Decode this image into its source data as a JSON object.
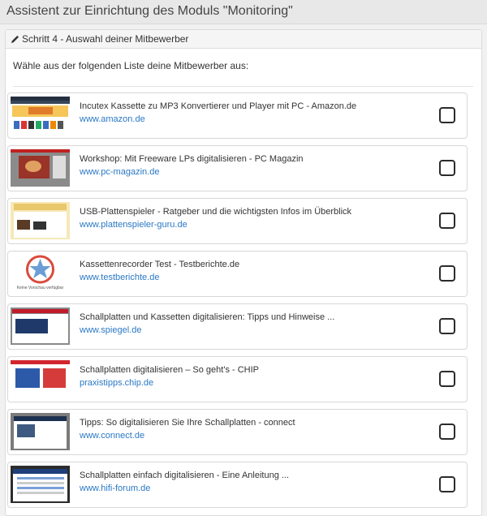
{
  "page": {
    "title": "Assistent zur Einrichtung des Moduls \"Monitoring\""
  },
  "panel": {
    "heading": "Schritt 4 - Auswahl deiner Mitbewerber",
    "intro": "Wähle aus der folgenden Liste deine Mitbewerber aus:"
  },
  "competitors": [
    {
      "title": "Incutex Kassette zu MP3 Konvertierer und Player mit PC - Amazon.de",
      "url": "www.amazon.de",
      "checked": false
    },
    {
      "title": "Workshop: Mit Freeware LPs digitalisieren - PC Magazin",
      "url": "www.pc-magazin.de",
      "checked": false
    },
    {
      "title": "USB-Plattenspieler - Ratgeber und die wichtigsten Infos im Überblick",
      "url": "www.plattenspieler-guru.de",
      "checked": false
    },
    {
      "title": "Kassettenrecorder Test - Testberichte.de",
      "url": "www.testberichte.de",
      "checked": false,
      "thumb_caption": "Keine Vorschau verfügbar"
    },
    {
      "title": "Schallplatten und Kassetten digitalisieren: Tipps und Hinweise ...",
      "url": "www.spiegel.de",
      "checked": false
    },
    {
      "title": "Schallplatten digitalisieren – So geht's - CHIP",
      "url": "praxistipps.chip.de",
      "checked": false
    },
    {
      "title": "Tipps: So digitalisieren Sie Ihre Schallplatten - connect",
      "url": "www.connect.de",
      "checked": false
    },
    {
      "title": "Schallplatten einfach digitalisieren - Eine Anleitung ...",
      "url": "www.hifi-forum.de",
      "checked": false
    }
  ],
  "colors": {
    "link": "#2a78c5",
    "header_bg": "#e8e8e8",
    "page_bg": "#f1f1f1"
  },
  "icons": {
    "step_heading": "pencil-icon",
    "placeholder_thumb": "star-icon"
  }
}
